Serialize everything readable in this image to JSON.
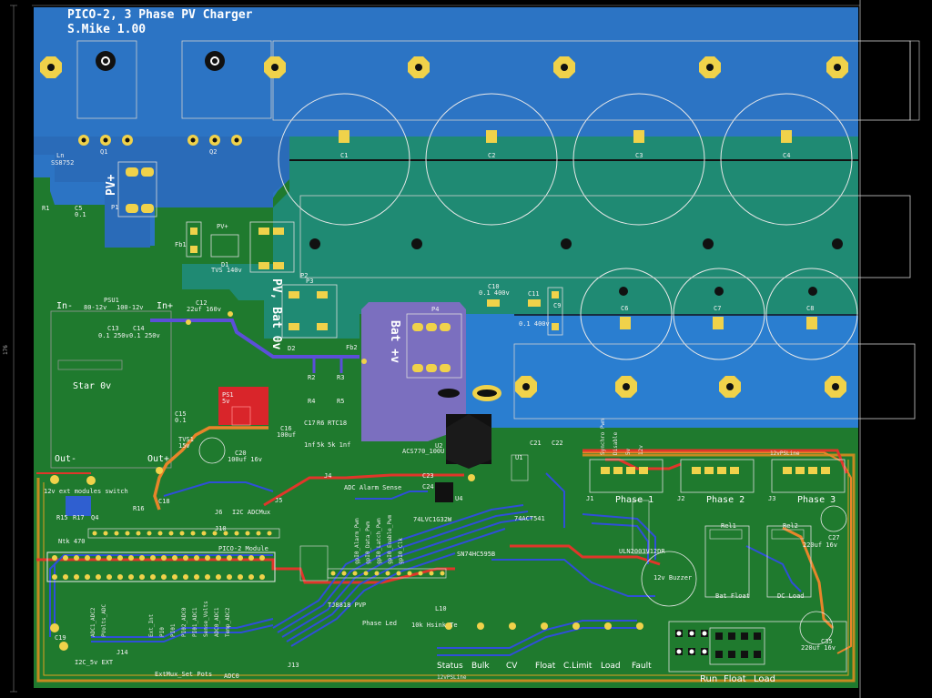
{
  "board": {
    "title": "PICO-2, 3 Phase PV Charger",
    "author_version": "S.Mike 1.00",
    "dimension_label": "176",
    "colors": {
      "background": "#000000",
      "top_copper": "#2a6db5",
      "pv_plane": "#2378c8",
      "bat_plane": "#1e8a70",
      "ground_plane": "#1f7a2e",
      "bat_zone": "#7b6fbf",
      "trace_red": "#e0362a",
      "trace_blue": "#2f4fd8",
      "trace_orange": "#e8852a",
      "pad_gold": "#f0d24a",
      "silkscreen": "#ffffff",
      "board_edge": "#d4a020"
    }
  },
  "power_labels": {
    "pv_plus": "PV+",
    "pv_bat_0v": "PV, Bat 0v",
    "bat_plus_v": "Bat +v",
    "star_0v": "Star 0v"
  },
  "components": {
    "caps_large": [
      "C1",
      "C2",
      "C3",
      "C4"
    ],
    "caps_mid": [
      "C6",
      "C7",
      "C8"
    ],
    "transistors": [
      "Q1",
      "Q2"
    ],
    "ic_lm": "Ln",
    "lm_part": "SS8752",
    "r1": "R1",
    "c5": "C5",
    "c5_val": "0.1",
    "p1": "P1",
    "fb1": "Fb1",
    "d1": "D1",
    "tvs": "TVS 140v",
    "pv_plus_small": "PV+",
    "p2": "P2",
    "p3": "P3",
    "p4": "P4",
    "c10": "C10",
    "c10_val": "0.1 400v",
    "c11": "C11",
    "c11_val": "0.1 400v",
    "c9": "C9",
    "psu1": "PSU1",
    "psu_in_minus": "In-",
    "psu_in_plus": "In+",
    "psu_out_minus": "Out-",
    "psu_out_plus": "Out+",
    "psu_range1": "80-12v",
    "psu_range2": "100-12v",
    "c13": "C13",
    "c14": "C14",
    "c13_val": "0.1 250v",
    "c14_val": "0.1 250v",
    "c12": "C12",
    "c12_val": "22uf 160v",
    "d2": "D2",
    "fb2": "Fb2",
    "ps1": "PS1",
    "ps1_val": "5v",
    "c15": "C15",
    "c15_val": "0.1",
    "c16": "C16",
    "c16_val": "100uf",
    "c17": "C17",
    "c17_val": "1nf",
    "r6": "R6",
    "r6_val": "5k",
    "rtc": "RTC18",
    "rtc_val": "5k 1nf",
    "r2": "R2",
    "r3": "R3",
    "r4": "R4",
    "r5": "R5",
    "tvs1": "TVS1",
    "tvs1_val": "15v",
    "c20": "C20",
    "c20_val": "100uf 16v",
    "u1": "U1",
    "u2": "U2",
    "acs": "ACS770_100U",
    "c21": "C21",
    "c22": "C22",
    "c23": "C23",
    "c24": "C24",
    "u4": "U4",
    "u4_part": "74LVC1G32W",
    "u3_part": "74ACT541",
    "u5_part": "SN74HC595B",
    "u6_part": "ULN2003V12DR",
    "tj_part": "TJ8818 PVP",
    "j4": "J4",
    "adc_alarm": "ADC Alarm Sense",
    "j5": "J5",
    "i2c_adc": "I2C ADCMux",
    "pico": "PICO-2_Module",
    "c9s": "C9",
    "j6": "J6",
    "j10": "J10",
    "ext_modules": "12v ext modules switch",
    "r15": "R15",
    "r16": "R16",
    "r17": "R17",
    "q4": "Q4",
    "ntk": "Ntk 470",
    "c18": "C18",
    "c19": "C19",
    "i2c_5v_ext": "I2C_5v EXT",
    "j14": "J14",
    "extmux": "ExtMux_Set Pots",
    "j13": "J13",
    "adc0": "ADC0",
    "phase1": "Phase 1",
    "phase2": "Phase 2",
    "phase3": "Phase 3",
    "j1": "J1",
    "j2": "J2",
    "j3": "J3",
    "c27": "C27",
    "c27_val": "220uf 16v",
    "c35": "C35",
    "c35_val": "220uf 16v",
    "rel1": "Rel1",
    "rel2": "Rel2",
    "buzzer": "12v Buzzer",
    "bat_float": "Bat Float",
    "dc_load": "DC Load",
    "phase_hdr_1": "Synchro Pwm",
    "phase_hdr_2": "Disable",
    "phase_hdr_3": "5v",
    "phase_hdr_4": "12v",
    "phase_led": "Phase Led",
    "hsink_te": "10k Hsink Te",
    "l10": "L10",
    "ps1_12v": "12vPSLine",
    "ps_12v_top": "12vPSLine"
  },
  "status_leds": [
    "Status",
    "Bulk",
    "CV",
    "Float",
    "C.Limit",
    "Load",
    "Fault"
  ],
  "relay_buttons": [
    "Run",
    "Float",
    "Load"
  ],
  "pin_labels_pico": [
    "Ext_Int",
    "PI0",
    "PI01",
    "PI02_ADC0",
    "PI01_ADC1",
    "Sense_Volts",
    "ADC0_ADC1",
    "Temp_ADC2",
    "ADC1_ADC2",
    "PVolts_ADC"
  ],
  "pin_labels_595": [
    "gpI0_Alarm_Pwm",
    "gpI0_Data_Pwm",
    "gpI0_Latch_Pwm",
    "gpI0_Enable_Pwm",
    "gpI0_Clk"
  ]
}
